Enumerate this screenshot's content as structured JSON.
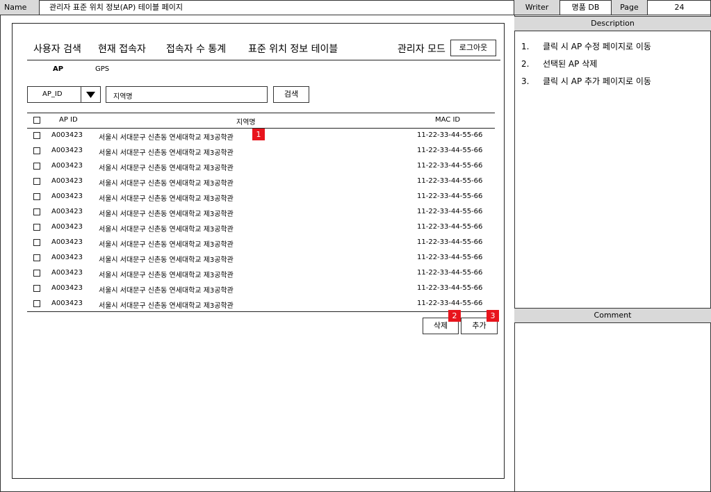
{
  "header": {
    "name_label": "Name",
    "page_name": "관리자 표준 위치 정보(AP) 테이블 페이지",
    "writer_label": "Writer",
    "writer_value": "명품 DB",
    "page_label": "Page",
    "page_number": "24"
  },
  "description": {
    "title": "Description",
    "items": [
      {
        "num": "1.",
        "text": "클릭 시 AP 수정 페이지로 이동"
      },
      {
        "num": "2.",
        "text": "선택된 AP 삭제"
      },
      {
        "num": "3.",
        "text": "클릭 시 AP 추가 페이지로 이동"
      }
    ]
  },
  "comment": {
    "title": "Comment"
  },
  "nav": {
    "items": [
      "사용자 검색",
      "현재 접속자",
      "접속자 수 통계",
      "표준 위치 정보 테이블"
    ],
    "admin_mode": "관리자 모드",
    "logout": "로그아웃"
  },
  "subtabs": [
    "AP",
    "GPS"
  ],
  "search": {
    "select_value": "AP_ID",
    "input_value": "지역명",
    "button": "검색"
  },
  "table": {
    "headers": {
      "ap_id": "AP ID",
      "region": "지역명",
      "mac_id": "MAC ID"
    },
    "rows": [
      {
        "ap_id": "A003423",
        "region": "서울시 서대문구 신촌동 연세대학교 제3공학관",
        "mac_id": "11-22-33-44-55-66"
      },
      {
        "ap_id": "A003423",
        "region": "서울시 서대문구 신촌동 연세대학교 제3공학관",
        "mac_id": "11-22-33-44-55-66"
      },
      {
        "ap_id": "A003423",
        "region": "서울시 서대문구 신촌동 연세대학교 제3공학관",
        "mac_id": "11-22-33-44-55-66"
      },
      {
        "ap_id": "A003423",
        "region": "서울시 서대문구 신촌동 연세대학교 제3공학관",
        "mac_id": "11-22-33-44-55-66"
      },
      {
        "ap_id": "A003423",
        "region": "서울시 서대문구 신촌동 연세대학교 제3공학관",
        "mac_id": "11-22-33-44-55-66"
      },
      {
        "ap_id": "A003423",
        "region": "서울시 서대문구 신촌동 연세대학교 제3공학관",
        "mac_id": "11-22-33-44-55-66"
      },
      {
        "ap_id": "A003423",
        "region": "서울시 서대문구 신촌동 연세대학교 제3공학관",
        "mac_id": "11-22-33-44-55-66"
      },
      {
        "ap_id": "A003423",
        "region": "서울시 서대문구 신촌동 연세대학교 제3공학관",
        "mac_id": "11-22-33-44-55-66"
      },
      {
        "ap_id": "A003423",
        "region": "서울시 서대문구 신촌동 연세대학교 제3공학관",
        "mac_id": "11-22-33-44-55-66"
      },
      {
        "ap_id": "A003423",
        "region": "서울시 서대문구 신촌동 연세대학교 제3공학관",
        "mac_id": "11-22-33-44-55-66"
      },
      {
        "ap_id": "A003423",
        "region": "서울시 서대문구 신촌동 연세대학교 제3공학관",
        "mac_id": "11-22-33-44-55-66"
      },
      {
        "ap_id": "A003423",
        "region": "서울시 서대문구 신촌동 연세대학교 제3공학관",
        "mac_id": "11-22-33-44-55-66"
      }
    ]
  },
  "actions": {
    "delete": "삭제",
    "add": "추가"
  },
  "markers": [
    "1",
    "2",
    "3"
  ],
  "colors": {
    "marker": "#e8141c",
    "panel_gray": "#d9d9d9"
  }
}
